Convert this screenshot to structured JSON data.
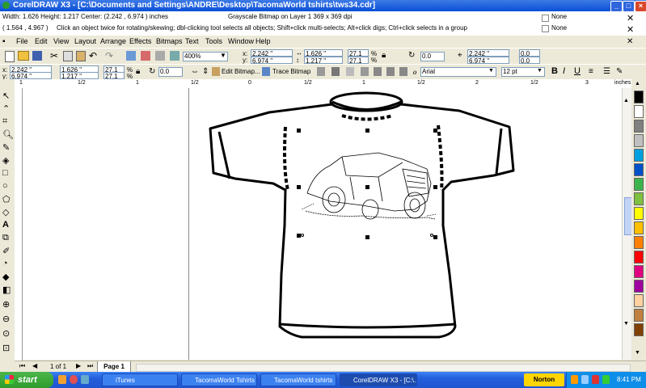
{
  "window": {
    "title": "CorelDRAW X3 - [C:\\Documents and Settings\\ANDRE\\Desktop\\TacomaWorld tshirts\\tws34.cdr]",
    "min": "_",
    "max": "□",
    "close": "×"
  },
  "status": {
    "size": "Width: 1.626  Height: 1.217  Center: (2.242 , 6.974 )  inches",
    "object": "Grayscale Bitmap on Layer 1 369 x 369 dpi",
    "fill": "None",
    "outline": "None",
    "coords": "( 1.564 , 4.967 )",
    "hint": "Click an object twice for rotating/skewing; dbl-clicking tool selects all objects; Shift+click multi-selects; Alt+click digs; Ctrl+click selects in a group"
  },
  "menu": [
    "File",
    "Edit",
    "View",
    "Layout",
    "Arrange",
    "Effects",
    "Bitmaps",
    "Text",
    "Tools",
    "Window",
    "Help"
  ],
  "standard_toolbar": {
    "zoom": "400%",
    "x": "2.242 \"",
    "y": "6.974 \"",
    "w": "1.626 \"",
    "h": "1.217 \"",
    "sx": "27.1",
    "sy": "27.1",
    "pct": "%",
    "angle": "0.0",
    "px": "2.242 \"",
    "py": "6.974 \"",
    "ox": "0.0",
    "oy": "0.0"
  },
  "property_bar": {
    "x": "2.242 \"",
    "y": "6.974 \"",
    "w": "1.626 \"",
    "h": "1.217 \"",
    "sx": "27.1",
    "sy": "27.1",
    "pct": "%",
    "angle": "0.0",
    "edit_bitmap": "Edit Bitmap...",
    "trace_bitmap": "Trace Bitmap",
    "font": "Arial",
    "font_size": "12 pt"
  },
  "ruler": {
    "ticks": [
      "1",
      "1/2",
      "1",
      "1/2",
      "0",
      "1/2",
      "1",
      "1/2",
      "2",
      "1/2",
      "3"
    ],
    "units": "inches"
  },
  "pages": {
    "counter": "1 of 1",
    "tab": "Page 1"
  },
  "taskbar": {
    "start": "start",
    "tasks": [
      "iTunes",
      "TacomaWorld Tshirts ...",
      "TacomaWorld tshirts",
      "CorelDRAW X3 - [C:\\..."
    ],
    "norton": "Norton",
    "time": "8:41 PM"
  },
  "colors": {
    "palette": [
      "#000000",
      "#ffffff",
      "#808080",
      "#c0c0c0",
      "#00a0e0",
      "#0050c8",
      "#3cb44b",
      "#80c040",
      "#ffff00",
      "#ffc000",
      "#ff8000",
      "#ff0000",
      "#e00080",
      "#a000a0",
      "#ffd0a0",
      "#c08040",
      "#804000"
    ],
    "titlebar": "#0a4fd6",
    "taskbar": "#245edb"
  }
}
